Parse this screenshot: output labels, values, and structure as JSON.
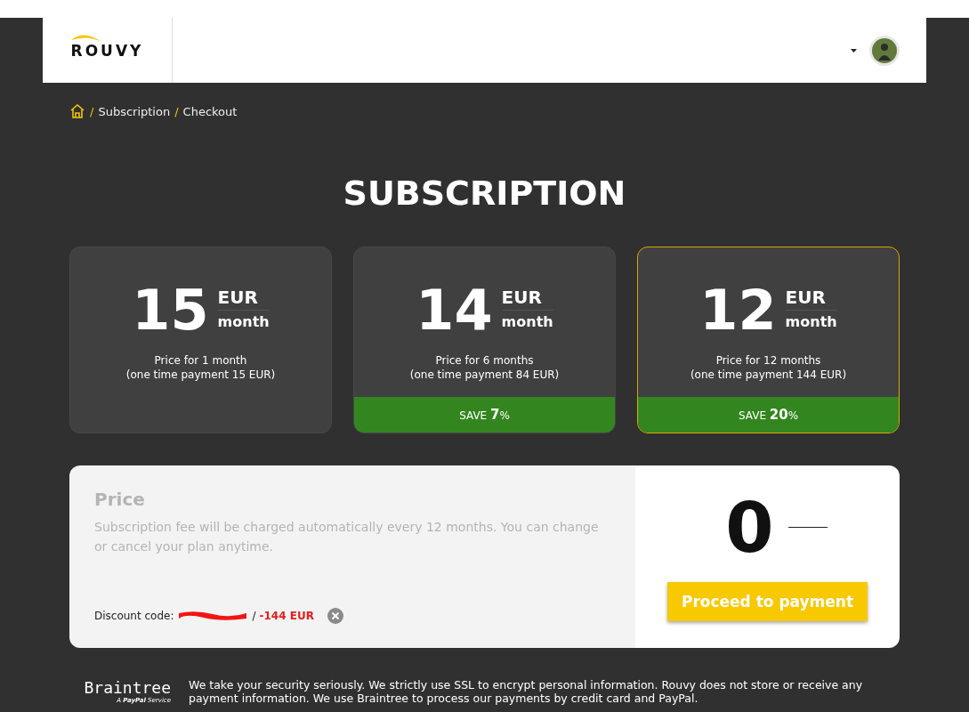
{
  "header": {
    "logo": "ROUVY"
  },
  "breadcrumb": [
    "Subscription",
    "Checkout"
  ],
  "breadcrumb_separator": "/",
  "title": "SUBSCRIPTION",
  "plans": [
    {
      "amount": "15",
      "currency": "EUR",
      "period": "month",
      "line1": "Price for 1 month",
      "line2": "(one time payment 15 EUR)",
      "selected": false
    },
    {
      "amount": "14",
      "currency": "EUR",
      "period": "month",
      "line1": "Price for 6 months",
      "line2": "(one time payment 84 EUR)",
      "save": "SAVE **7**%",
      "selected": false
    },
    {
      "amount": "12",
      "currency": "EUR",
      "period": "month",
      "line1": "Price for 12 months",
      "line2": "(one time payment 144 EUR)",
      "save": "SAVE **20**%",
      "selected": true
    }
  ],
  "price": {
    "heading": "Price",
    "description": "Subscription fee will be charged automatically every 12 months. You can change or cancel your plan anytime.",
    "discount_label": "Discount code:",
    "discount_separator": "/",
    "discount_value": "-144 EUR",
    "total": "0",
    "button": "Proceed to payment"
  },
  "footer": {
    "brand": "Braintree",
    "brand_sub": "A **PayPal** Service",
    "text": "We take your security seriously. We strictly use SSL to encrypt personal information. Rouvy does not store or receive any payment information. We use Braintree to process our payments by credit card and PayPal."
  }
}
